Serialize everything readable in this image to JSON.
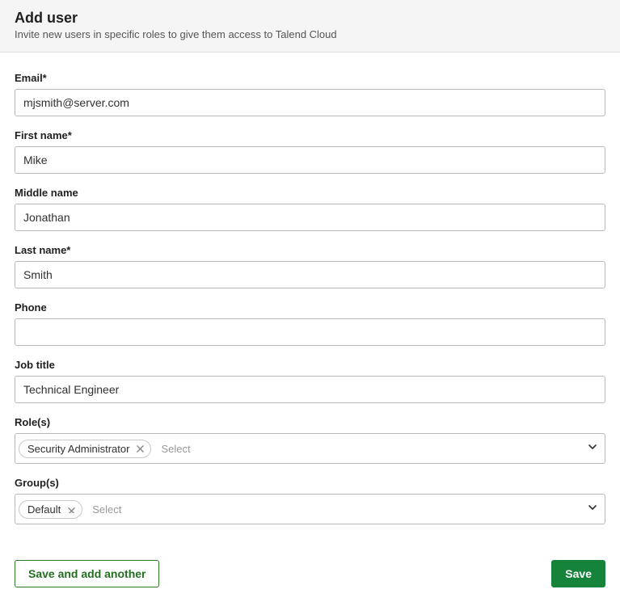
{
  "header": {
    "title": "Add user",
    "subtitle": "Invite new users in specific roles to give them access to Talend Cloud"
  },
  "form": {
    "email": {
      "label": "Email*",
      "value": "mjsmith@server.com"
    },
    "firstName": {
      "label": "First name*",
      "value": "Mike"
    },
    "middleName": {
      "label": "Middle name",
      "value": "Jonathan"
    },
    "lastName": {
      "label": "Last name*",
      "value": "Smith"
    },
    "phone": {
      "label": "Phone",
      "value": ""
    },
    "jobTitle": {
      "label": "Job title",
      "value": "Technical Engineer"
    },
    "roles": {
      "label": "Role(s)",
      "placeholder": "Select",
      "selected": [
        "Security Administrator"
      ]
    },
    "groups": {
      "label": "Group(s)",
      "placeholder": "Select",
      "selected": [
        "Default"
      ]
    }
  },
  "buttons": {
    "saveAndAddAnother": "Save and add another",
    "save": "Save"
  }
}
